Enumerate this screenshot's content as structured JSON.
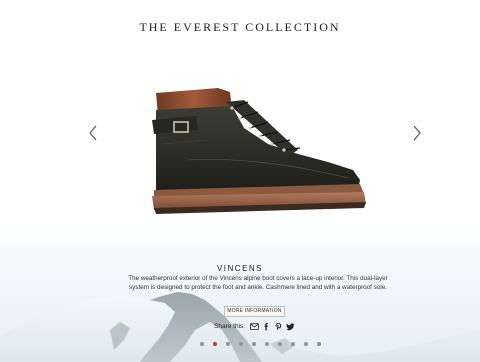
{
  "header": {
    "title": "THE EVEREST COLLECTION"
  },
  "carousel": {
    "prev_icon": "chevron-left-icon",
    "next_icon": "chevron-right-icon",
    "slide_count": 10,
    "active_index": 1
  },
  "product": {
    "name": "VINCENS",
    "description": "The weatherproof exterior of the Vincens alpine boot covers a lace-up interior. This dual-layer system is designed to protect the foot and ankle. Cashmere lined and with a waterproof sole.",
    "more_label": "MORE INFORMATION"
  },
  "share": {
    "label": "Share this:",
    "icons": [
      "email-icon",
      "facebook-icon",
      "pinterest-icon",
      "twitter-icon"
    ]
  },
  "colors": {
    "active_dot": "#d53024",
    "inactive_dot": "#8f9497",
    "leather": "#2a2b24",
    "collar": "#8a4a2a",
    "sole": "#a0664a"
  }
}
